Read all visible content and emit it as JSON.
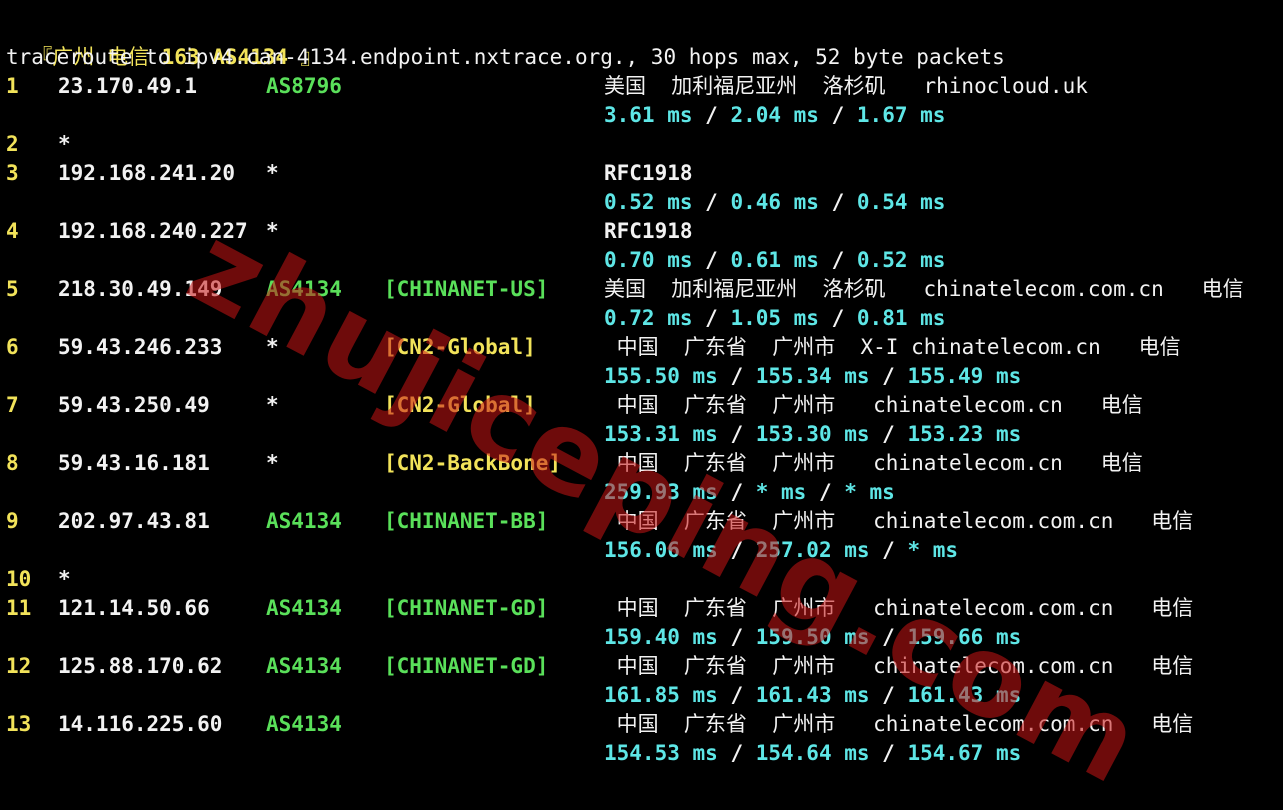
{
  "header": {
    "title_open": "『广州 电信 ",
    "title_bold": "163 AS4134",
    "title_close": " 』",
    "trace_line": "traceroute to ipv4.can-4134.endpoint.nxtrace.org., 30 hops max, 52 byte packets"
  },
  "hops": [
    {
      "n": "1",
      "ip": "23.170.49.1",
      "asn": "AS8796",
      "asn_style": "g",
      "tag": "",
      "tag_style": "",
      "geo": "美国  加利福尼亚州  洛杉矶   rhinocloud.uk",
      "geo_bold": "",
      "rtt": "3.61 ms / 2.04 ms / 1.67 ms"
    },
    {
      "n": "2",
      "ip": "*",
      "asn": "",
      "asn_style": "",
      "tag": "",
      "tag_style": "",
      "geo": "",
      "geo_bold": "",
      "rtt": ""
    },
    {
      "n": "3",
      "ip": "192.168.241.20",
      "asn": "*",
      "asn_style": "w",
      "tag": "",
      "tag_style": "",
      "geo": "",
      "geo_bold": "RFC1918",
      "rtt": "0.52 ms / 0.46 ms / 0.54 ms"
    },
    {
      "n": "4",
      "ip": "192.168.240.227",
      "asn": "*",
      "asn_style": "w",
      "tag": "",
      "tag_style": "",
      "geo": "",
      "geo_bold": "RFC1918",
      "rtt": "0.70 ms / 0.61 ms / 0.52 ms"
    },
    {
      "n": "5",
      "ip": "218.30.49.149",
      "asn": "AS4134",
      "asn_style": "g",
      "tag": "[CHINANET-US]",
      "tag_style": "g",
      "geo": "美国  加利福尼亚州  洛杉矶   chinatelecom.com.cn   电信",
      "geo_bold": "",
      "rtt": "0.72 ms / 1.05 ms / 0.81 ms"
    },
    {
      "n": "6",
      "ip": "59.43.246.233",
      "asn": "*",
      "asn_style": "w",
      "tag": "[CN2-Global]",
      "tag_style": "y",
      "geo": " 中国  广东省  广州市  X-I chinatelecom.cn   电信",
      "geo_bold": "",
      "rtt": "155.50 ms / 155.34 ms / 155.49 ms"
    },
    {
      "n": "7",
      "ip": "59.43.250.49",
      "asn": "*",
      "asn_style": "w",
      "tag": "[CN2-Global]",
      "tag_style": "y",
      "geo": " 中国  广东省  广州市   chinatelecom.cn   电信",
      "geo_bold": "",
      "rtt": "153.31 ms / 153.30 ms / 153.23 ms"
    },
    {
      "n": "8",
      "ip": "59.43.16.181",
      "asn": "*",
      "asn_style": "w",
      "tag": "[CN2-BackBone]",
      "tag_style": "y",
      "geo": " 中国  广东省  广州市   chinatelecom.cn   电信",
      "geo_bold": "",
      "rtt": "259.93 ms / * ms / * ms"
    },
    {
      "n": "9",
      "ip": "202.97.43.81",
      "asn": "AS4134",
      "asn_style": "g",
      "tag": "[CHINANET-BB]",
      "tag_style": "g",
      "geo": " 中国  广东省  广州市   chinatelecom.com.cn   电信",
      "geo_bold": "",
      "rtt": "156.06 ms / 257.02 ms / * ms"
    },
    {
      "n": "10",
      "ip": "*",
      "asn": "",
      "asn_style": "",
      "tag": "",
      "tag_style": "",
      "geo": "",
      "geo_bold": "",
      "rtt": ""
    },
    {
      "n": "11",
      "ip": "121.14.50.66",
      "asn": "AS4134",
      "asn_style": "g",
      "tag": "[CHINANET-GD]",
      "tag_style": "g",
      "geo": " 中国  广东省  广州市   chinatelecom.com.cn   电信",
      "geo_bold": "",
      "rtt": "159.40 ms / 159.50 ms / 159.66 ms"
    },
    {
      "n": "12",
      "ip": "125.88.170.62",
      "asn": "AS4134",
      "asn_style": "g",
      "tag": "[CHINANET-GD]",
      "tag_style": "g",
      "geo": " 中国  广东省  广州市   chinatelecom.com.cn   电信",
      "geo_bold": "",
      "rtt": "161.85 ms / 161.43 ms / 161.43 ms"
    },
    {
      "n": "13",
      "ip": "14.116.225.60",
      "asn": "AS4134",
      "asn_style": "g",
      "tag": "",
      "tag_style": "",
      "geo": " 中国  广东省  广州市   chinatelecom.com.cn   电信",
      "geo_bold": "",
      "rtt": "154.53 ms / 154.64 ms / 154.67 ms"
    }
  ],
  "watermark": "zhujiceping.com"
}
